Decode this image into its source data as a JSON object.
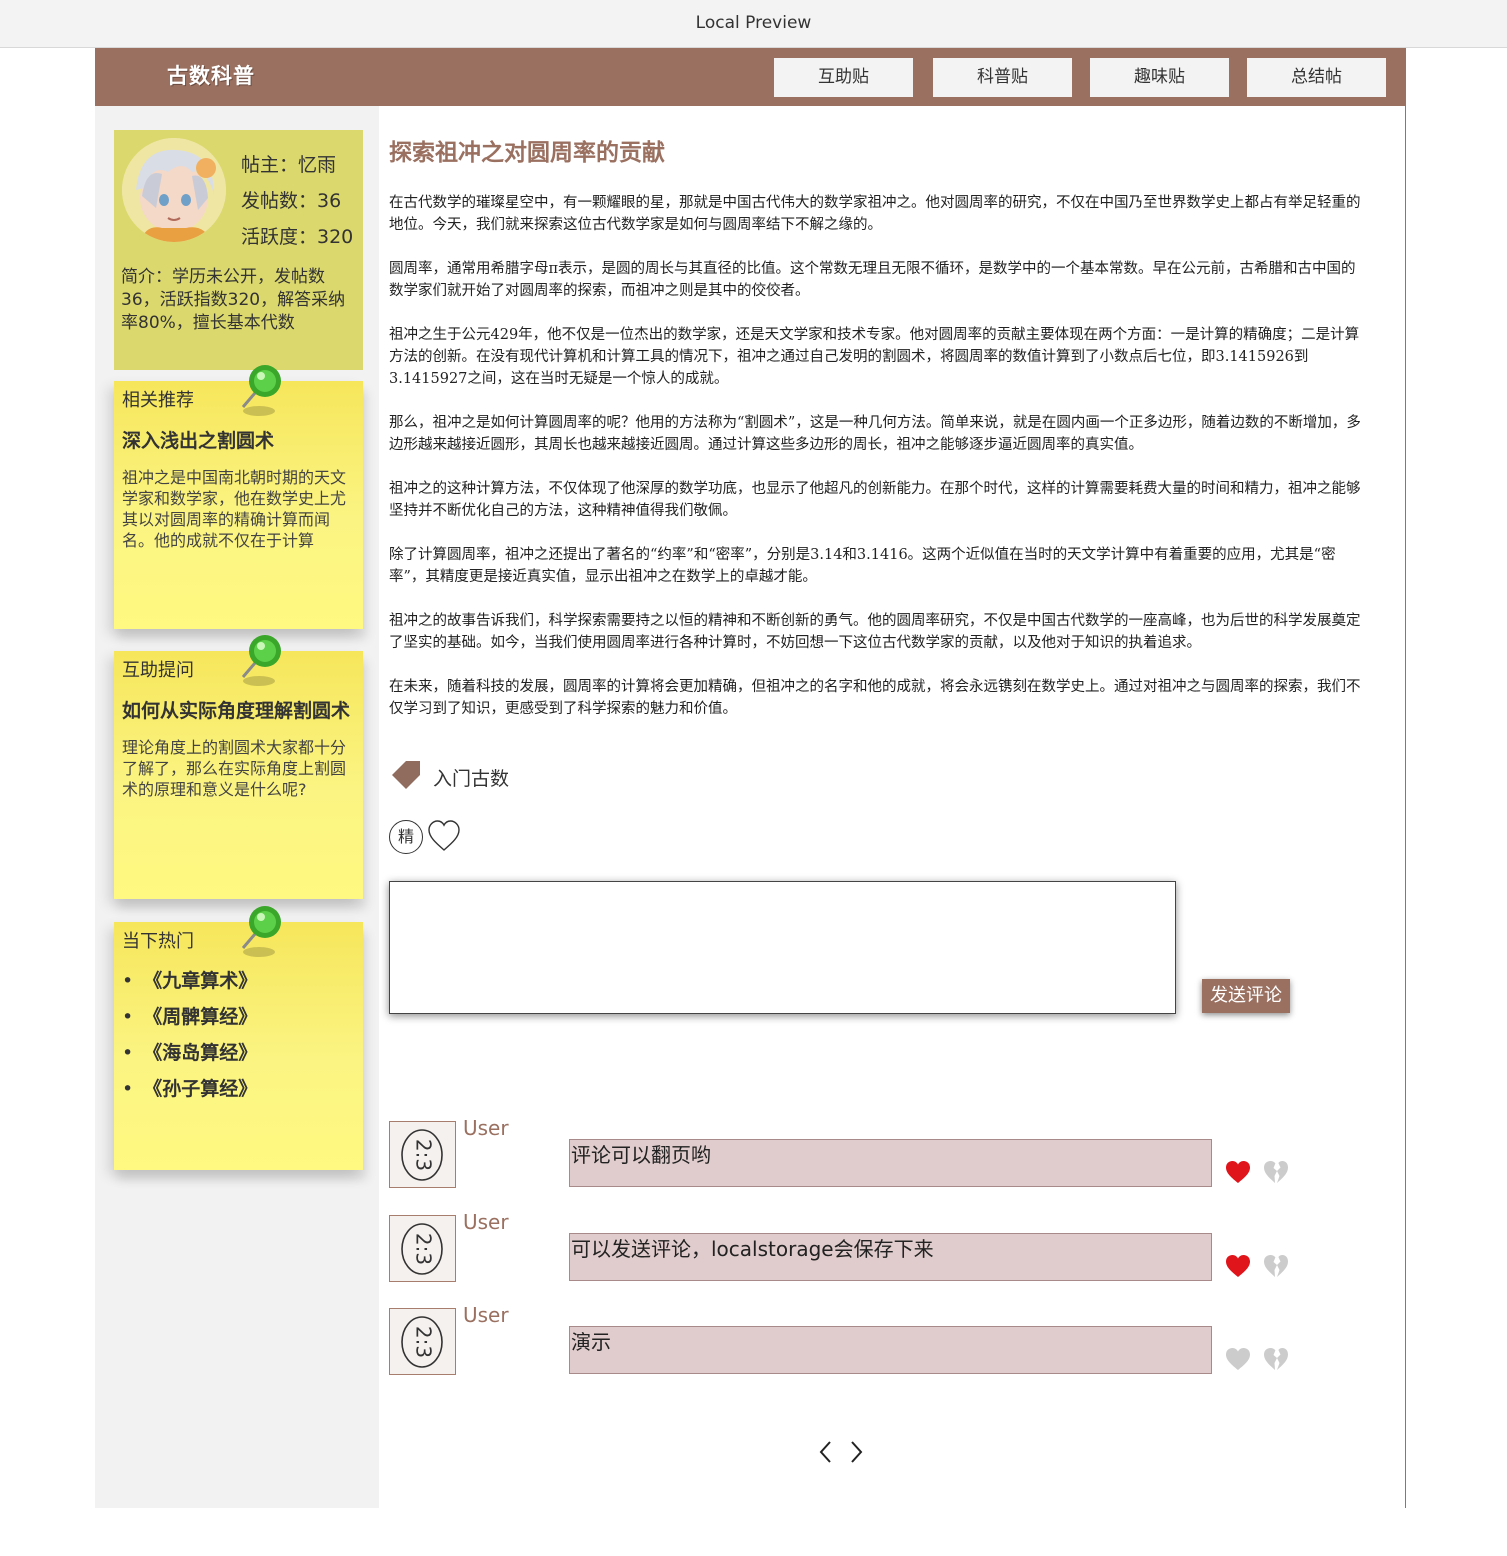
{
  "preview": {
    "title": "Local Preview"
  },
  "nav": {
    "logo": "古数科普",
    "buttons": [
      "互助贴",
      "科普贴",
      "趣味贴",
      "总结帖"
    ]
  },
  "profile": {
    "owner": "帖主：忆雨",
    "posts": "发帖数：36",
    "activity": "活跃度：320",
    "intro": "简介：学历未公开，发帖数36，活跃指数320，解答采纳率80%，擅长基本代数"
  },
  "related": {
    "heading": "相关推荐",
    "title": "深入浅出之割圆术",
    "text": "祖冲之是中国南北朝时期的天文学家和数学家，他在数学史上尤其以对圆周率的精确计算而闻名。他的成就不仅在于计算"
  },
  "help": {
    "heading": "互助提问",
    "title": "如何从实际角度理解割圆术",
    "text": "理论角度上的割圆术大家都十分了解了，那么在实际角度上割圆术的原理和意义是什么呢?"
  },
  "hot": {
    "heading": "当下热门",
    "items": [
      "《九章算术》",
      "《周髀算经》",
      "《海岛算经》",
      "《孙子算经》"
    ]
  },
  "article": {
    "title": "探索祖冲之对圆周率的贡献",
    "paragraphs": [
      "在古代数学的璀璨星空中，有一颗耀眼的星，那就是中国古代伟大的数学家祖冲之。他对圆周率的研究，不仅在中国乃至世界数学史上都占有举足轻重的地位。今天，我们就来探索这位古代数学家是如何与圆周率结下不解之缘的。",
      "圆周率，通常用希腊字母π表示，是圆的周长与其直径的比值。这个常数无理且无限不循环，是数学中的一个基本常数。早在公元前，古希腊和古中国的数学家们就开始了对圆周率的探索，而祖冲之则是其中的佼佼者。",
      "祖冲之生于公元429年，他不仅是一位杰出的数学家，还是天文学家和技术专家。他对圆周率的贡献主要体现在两个方面：一是计算的精确度；二是计算方法的创新。在没有现代计算机和计算工具的情况下，祖冲之通过自己发明的割圆术，将圆周率的数值计算到了小数点后七位，即3.1415926到3.1415927之间，这在当时无疑是一个惊人的成就。",
      "那么，祖冲之是如何计算圆周率的呢？他用的方法称为“割圆术”，这是一种几何方法。简单来说，就是在圆内画一个正多边形，随着边数的不断增加，多边形越来越接近圆形，其周长也越来越接近圆周。通过计算这些多边形的周长，祖冲之能够逐步逼近圆周率的真实值。",
      "祖冲之的这种计算方法，不仅体现了他深厚的数学功底，也显示了他超凡的创新能力。在那个时代，这样的计算需要耗费大量的时间和精力，祖冲之能够坚持并不断优化自己的方法，这种精神值得我们敬佩。",
      "除了计算圆周率，祖冲之还提出了著名的“约率”和“密率”，分别是3.14和3.1416。这两个近似值在当时的天文学计算中有着重要的应用，尤其是“密率”，其精度更是接近真实值，显示出祖冲之在数学上的卓越才能。",
      "祖冲之的故事告诉我们，科学探索需要持之以恒的精神和不断创新的勇气。他的圆周率研究，不仅是中国古代数学的一座高峰，也为后世的科学发展奠定了坚实的基础。如今，当我们使用圆周率进行各种计算时，不妨回想一下这位古代数学家的贡献，以及他对于知识的执着追求。",
      "在未来，随着科技的发展，圆周率的计算将会更加精确，但祖冲之的名字和他的成就，将会永远镌刻在数学史上。通过对祖冲之与圆周率的探索，我们不仅学习到了知识，更感受到了科学探索的魅力和价值。"
    ],
    "tag": "入门古数",
    "essence_badge": "精"
  },
  "comment_form": {
    "value": "",
    "send_label": "发送评论"
  },
  "comments": [
    {
      "user": "User",
      "text": "评论可以翻页哟",
      "liked": true,
      "avatar_text": "2:3"
    },
    {
      "user": "User",
      "text": "可以发送评论，localstorage会保存下来",
      "liked": true,
      "avatar_text": "2:3"
    },
    {
      "user": "User",
      "text": "演示",
      "liked": false,
      "avatar_text": "2:3"
    }
  ],
  "colors": {
    "brand": "#9a7060",
    "profile_bg": "#dbd86d",
    "note_bg": "#fbf482",
    "comment_bg": "#e0cccc",
    "like_active": "#e0141b",
    "like_inactive": "#cccccc"
  },
  "icons": {
    "pin": "green-pushpin-icon",
    "tag": "tag-icon",
    "like": "heart-icon",
    "dislike": "broken-heart-icon",
    "prev": "chevron-left-icon",
    "next": "chevron-right-icon"
  }
}
